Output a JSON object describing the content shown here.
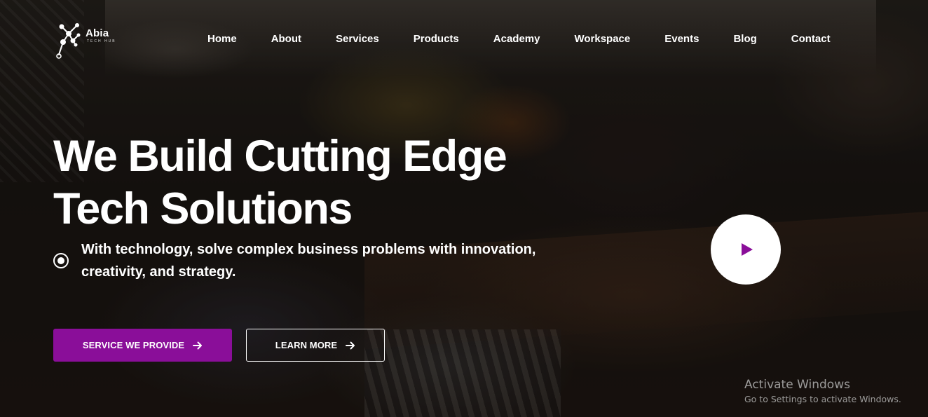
{
  "brand": {
    "name": "Abia",
    "sub": "TECH HUB",
    "accent_color": "#8a0e99"
  },
  "nav": {
    "items": [
      {
        "label": "Home"
      },
      {
        "label": "About"
      },
      {
        "label": "Services"
      },
      {
        "label": "Products"
      },
      {
        "label": "Academy"
      },
      {
        "label": "Workspace"
      },
      {
        "label": "Events"
      },
      {
        "label": "Blog"
      },
      {
        "label": "Contact"
      }
    ]
  },
  "hero": {
    "title_line1": "We Build Cutting Edge",
    "title_line2": "Tech Solutions",
    "tagline": "With technology, solve complex business problems with innovation, creativity, and strategy.",
    "primary_button": "SERVICE WE PROVIDE",
    "secondary_button": "LEARN MORE",
    "play_icon": "play-icon",
    "arrow_icon": "arrow-right-icon"
  },
  "watermark": {
    "title": "Activate Windows",
    "subtitle": "Go to Settings to activate Windows."
  }
}
